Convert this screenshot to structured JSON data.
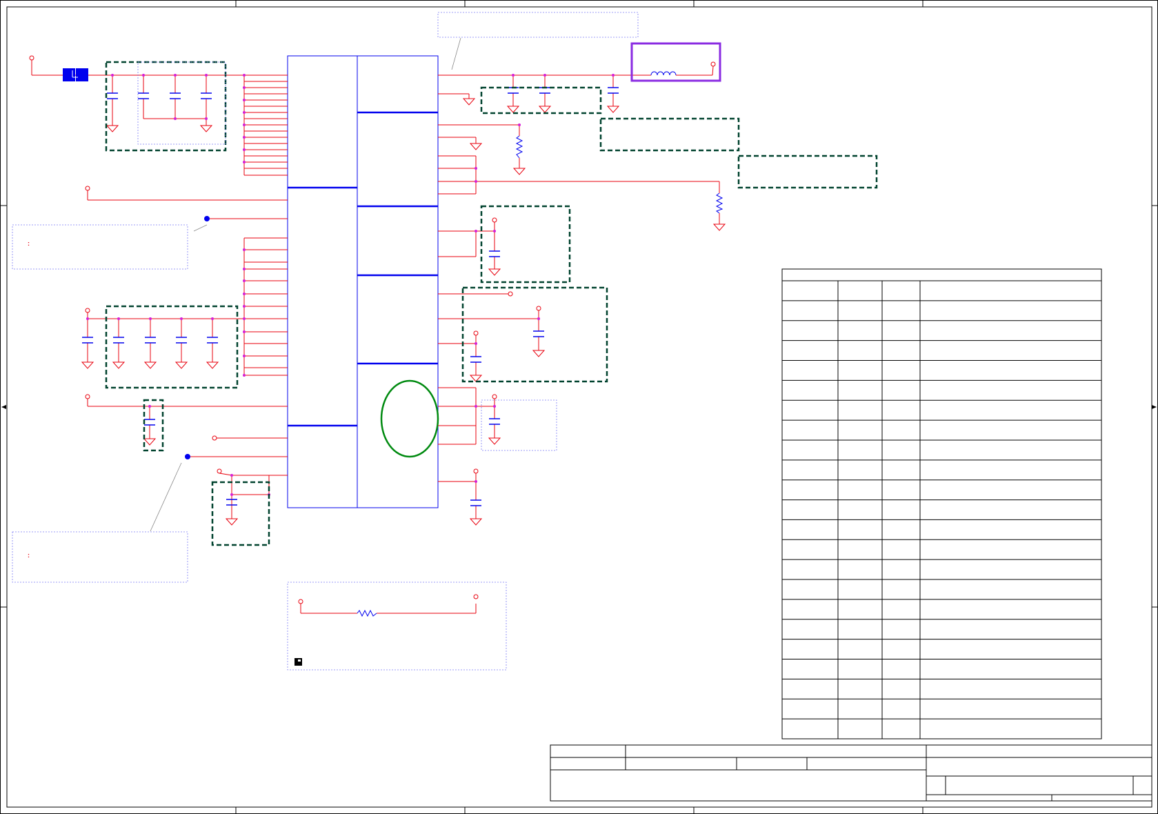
{
  "schematic": {
    "colors": {
      "wire": "#e8000d",
      "junction": "#d61fd6",
      "ic_outline": "#0000ee",
      "bus": "#0000ee",
      "capacitor": "#0000ee",
      "group_box": "#00422e",
      "note_box": "#7b7bf5",
      "highlight_box": "#8a2be2",
      "test_point": "#0000ee",
      "ellipse": "#008a10",
      "border": "#000000"
    },
    "icons": [
      "ground-symbol-icon",
      "capacitor-icon",
      "inductor-icon",
      "resistor-icon",
      "power-port-icon",
      "test-point-icon",
      "connector-icon"
    ],
    "note_markers": [
      ":",
      ":"
    ],
    "table": {
      "rows": 23,
      "columns": 4
    },
    "title_block": {
      "sheet_number": ""
    }
  }
}
